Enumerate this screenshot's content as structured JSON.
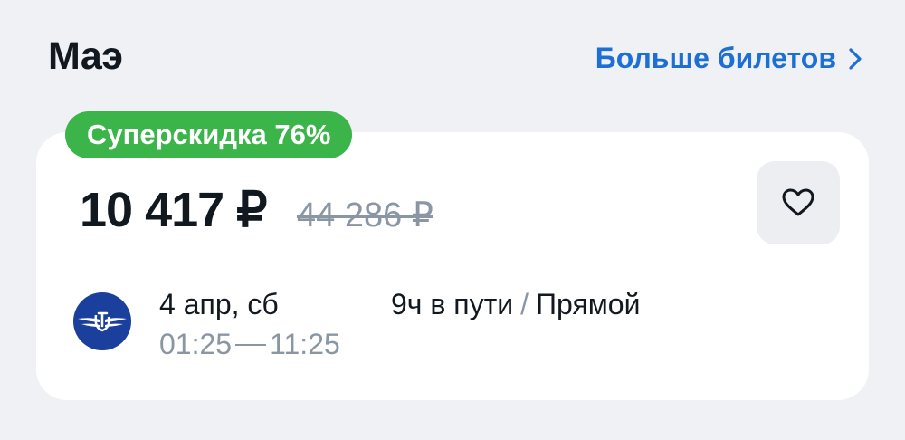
{
  "header": {
    "title": "Маэ",
    "more_link": "Больше билетов"
  },
  "offer": {
    "badge": "Суперскидка 76%",
    "price": "10 417 ₽",
    "old_price": "44 286 ₽",
    "date": "4 апр, сб",
    "depart_time": "01:25",
    "arrive_time": "11:25",
    "duration": "9ч в пути",
    "flight_type": "Прямой",
    "separator": "/"
  },
  "colors": {
    "accent": "#1d6fd6",
    "badge": "#3bb44a",
    "airline_logo": "#1b3f9c"
  },
  "icons": {
    "more": "chevron-right-icon",
    "favorite": "heart-icon",
    "airline": "airline-logo"
  }
}
